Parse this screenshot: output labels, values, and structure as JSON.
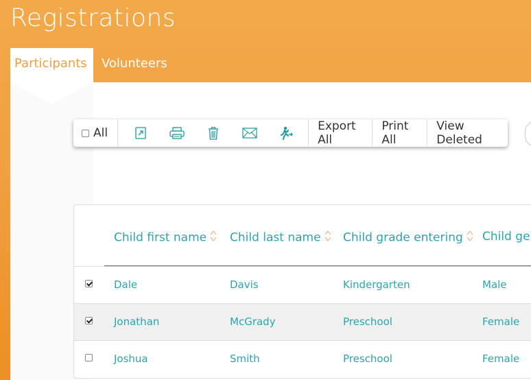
{
  "page": {
    "title": "Registrations"
  },
  "tabs": [
    {
      "label": "Participants",
      "active": true
    },
    {
      "label": "Volunteers",
      "active": false
    }
  ],
  "toolbar": {
    "select_all_label": "All",
    "icons": [
      "export-icon",
      "print-icon",
      "trash-icon",
      "mail-icon",
      "checkin-runner-icon"
    ],
    "export_all": "Export All",
    "print_all": "Print All",
    "view_deleted": "View Deleted"
  },
  "table": {
    "columns": [
      "Child first name",
      "Child last name",
      "Child grade entering",
      "Child gen"
    ],
    "rows": [
      {
        "checked": true,
        "first": "Dale",
        "last": "Davis",
        "grade": "Kindergarten",
        "gender": "Male"
      },
      {
        "checked": true,
        "first": "Jonathan",
        "last": "McGrady",
        "grade": "Preschool",
        "gender": "Female"
      },
      {
        "checked": false,
        "first": "Joshua",
        "last": "Smith",
        "grade": "Preschool",
        "gender": "Female"
      }
    ]
  },
  "colors": {
    "accent": "#f0a040",
    "link": "#2aa4b0",
    "icon": "#1a9aa0"
  }
}
